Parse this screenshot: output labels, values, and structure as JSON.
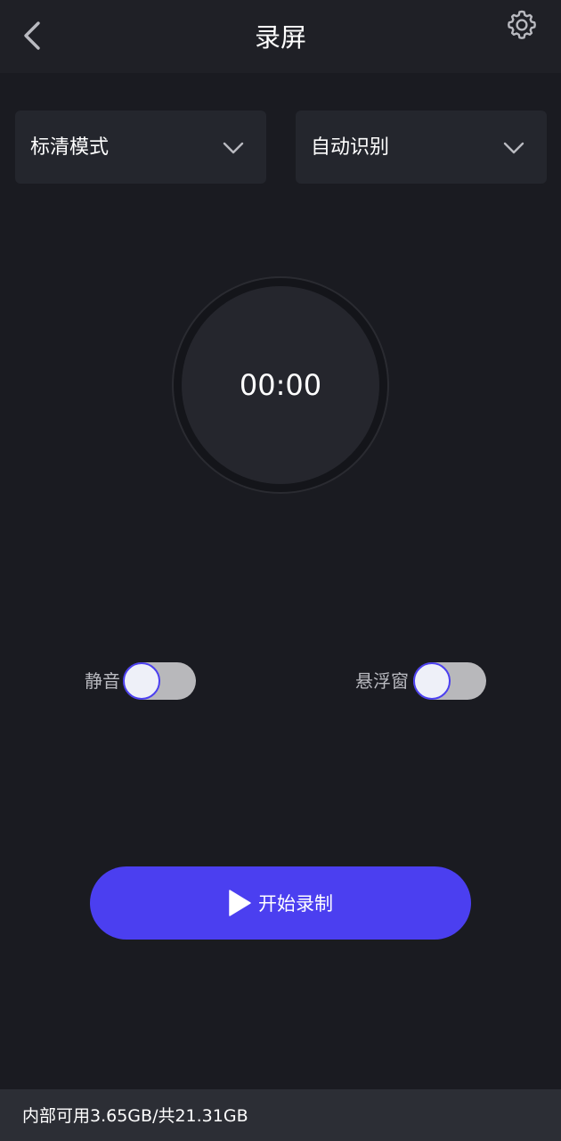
{
  "header": {
    "title": "录屏",
    "back_icon": "chevron-left-icon",
    "settings_icon": "gear-icon"
  },
  "dropdowns": {
    "quality": {
      "selected": "标清模式"
    },
    "orientation": {
      "selected": "自动识别"
    }
  },
  "timer": {
    "value": "00:00"
  },
  "toggles": {
    "mute": {
      "label": "静音",
      "on": false
    },
    "floating_window": {
      "label": "悬浮窗",
      "on": false
    }
  },
  "start_button": {
    "label": "开始录制",
    "icon": "play-icon"
  },
  "footer": {
    "storage_text": "内部可用3.65GB/共21.31GB"
  },
  "colors": {
    "background": "#1a1b21",
    "header": "#1f2026",
    "card": "#24262d",
    "accent": "#4b3ff0",
    "footer": "#2c2e35"
  }
}
